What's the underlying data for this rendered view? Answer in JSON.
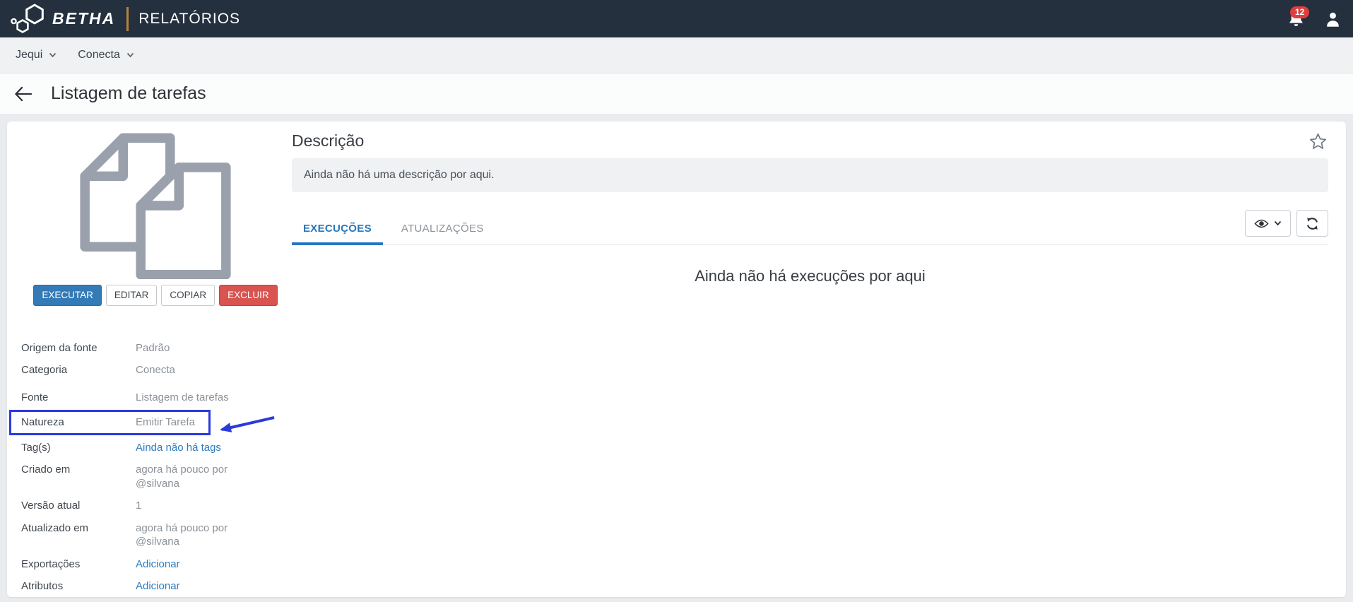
{
  "navbar": {
    "brand": "BETHA",
    "app_title": "RELATÓRIOS",
    "notification_count": "12"
  },
  "breadcrumb": {
    "entity": "Jequi",
    "context": "Conecta"
  },
  "page": {
    "title": "Listagem de tarefas"
  },
  "report": {
    "actions": {
      "execute": "EXECUTAR",
      "edit": "EDITAR",
      "copy": "COPIAR",
      "delete": "EXCLUIR"
    },
    "details": {
      "rows": [
        {
          "label": "Origem da fonte",
          "value": "Padrão"
        },
        {
          "label": "Categoria",
          "value": "Conecta"
        },
        {
          "label": "Fonte",
          "value": "Listagem de tarefas"
        },
        {
          "label": "Natureza",
          "value": "Emitir Tarefa",
          "highlighted": true
        },
        {
          "label": "Tag(s)",
          "value": "Ainda não há tags",
          "link": true
        },
        {
          "label": "Criado em",
          "value": "agora há pouco por @silvana"
        },
        {
          "label": "Versão atual",
          "value": "1"
        },
        {
          "label": "Atualizado em",
          "value": "agora há pouco por @silvana"
        },
        {
          "label": "Exportações",
          "value": "Adicionar",
          "link": true
        },
        {
          "label": "Atributos",
          "value": "Adicionar",
          "link": true
        }
      ]
    }
  },
  "description": {
    "title": "Descrição",
    "empty_text": "Ainda não há uma descrição por aqui."
  },
  "tabs": {
    "executions": "EXECUÇÕES",
    "updates": "ATUALIZAÇÕES"
  },
  "executions": {
    "empty_text": "Ainda não há execuções por aqui"
  },
  "colors": {
    "navbar_bg": "#24303e",
    "brand_divider": "#b5833d",
    "primary": "#337ab7",
    "danger": "#d9534f",
    "link": "#2e7bc0",
    "tab_active": "#2776bd",
    "annotation_highlight": "#2b3ad9",
    "badge": "#e03e3e"
  }
}
